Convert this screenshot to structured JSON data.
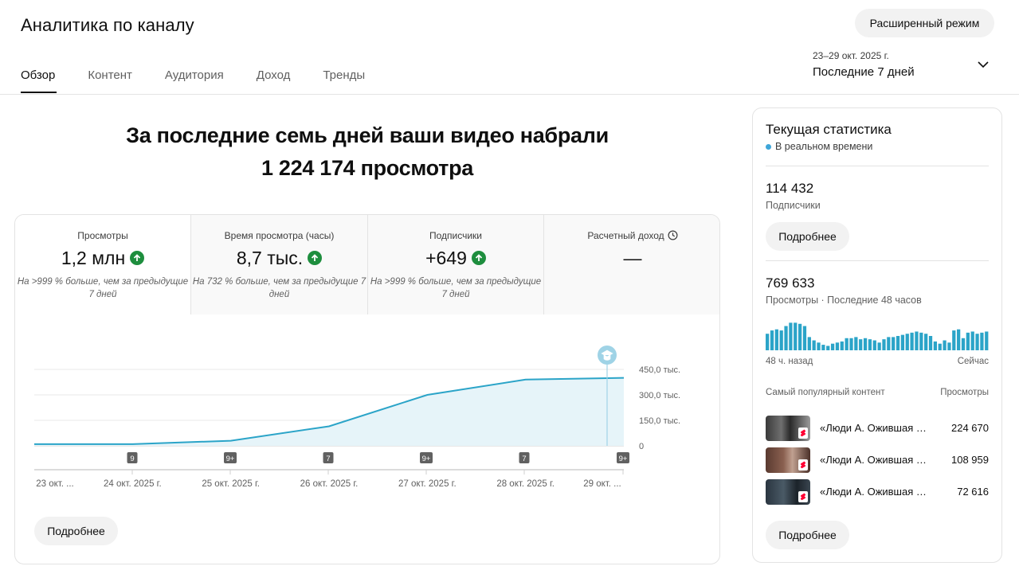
{
  "header": {
    "title": "Аналитика по каналу",
    "advanced_button": "Расширенный режим",
    "tabs": [
      "Обзор",
      "Контент",
      "Аудитория",
      "Доход",
      "Тренды"
    ],
    "active_tab": 0,
    "date_range": "23–29 окт. 2025 г.",
    "date_label": "Последние 7 дней"
  },
  "headline": {
    "line1": "За последние семь дней ваши видео набрали",
    "line2": "1 224 174 просмотра"
  },
  "metrics": [
    {
      "label": "Просмотры",
      "value": "1,2 млн",
      "trend": "up",
      "note": "На >999 % больше, чем за предыдущие 7 дней"
    },
    {
      "label": "Время просмотра (часы)",
      "value": "8,7 тыс.",
      "trend": "up",
      "note": "На 732 % больше, чем за предыдущие 7 дней"
    },
    {
      "label": "Подписчики",
      "value": "+649",
      "trend": "up",
      "note": "На >999 % больше, чем за предыдущие 7 дней"
    },
    {
      "label": "Расчетный доход",
      "value": "—",
      "trend": "none",
      "note": ""
    }
  ],
  "chart_data": {
    "type": "area",
    "x": [
      "23 окт. ...",
      "24 окт. 2025 г.",
      "25 окт. 2025 г.",
      "26 окт. 2025 г.",
      "27 окт. 2025 г.",
      "28 окт. 2025 г.",
      "29 окт. ..."
    ],
    "series": [
      {
        "values": [
          10000,
          10000,
          30000,
          115000,
          300000,
          390000,
          400000
        ]
      }
    ],
    "y_ticks": [
      0,
      150000,
      300000,
      450000
    ],
    "y_tick_labels": [
      "0",
      "150,0 тыс.",
      "300,0 тыс.",
      "450,0 тыс."
    ],
    "ylim": [
      0,
      450000
    ],
    "upload_markers": [
      "9",
      "9+",
      "7",
      "9+",
      "7",
      "9+"
    ],
    "milestone_icon": "graduation-cap-icon",
    "color": "#2ba4c8"
  },
  "card_button": "Подробнее",
  "realtime": {
    "title": "Текущая статистика",
    "live_label": "В реальном времени",
    "subscribers_value": "114 432",
    "subscribers_label": "Подписчики",
    "subscribers_button": "Подробнее",
    "views_value": "769 633",
    "views_label": "Просмотры · Последние 48 часов",
    "hourly_views": [
      30,
      36,
      38,
      36,
      44,
      50,
      50,
      48,
      44,
      24,
      18,
      14,
      10,
      8,
      12,
      14,
      16,
      22,
      22,
      24,
      20,
      22,
      20,
      18,
      14,
      20,
      24,
      24,
      26,
      28,
      30,
      32,
      34,
      32,
      30,
      26,
      16,
      12,
      18,
      14,
      36,
      38,
      22,
      32,
      34,
      30,
      32,
      34
    ],
    "axis_start": "48 ч. назад",
    "axis_end": "Сейчас",
    "top_content_header": "Самый популярный контент",
    "top_content_metric": "Просмотры",
    "top_content": [
      {
        "title": "«Люди А. Ожившая история»",
        "views": "224 670"
      },
      {
        "title": "«Люди А. Ожившая история»",
        "views": "108 959"
      },
      {
        "title": "«Люди А. Ожившая история»",
        "views": "72 616"
      }
    ],
    "more_button": "Подробнее"
  }
}
